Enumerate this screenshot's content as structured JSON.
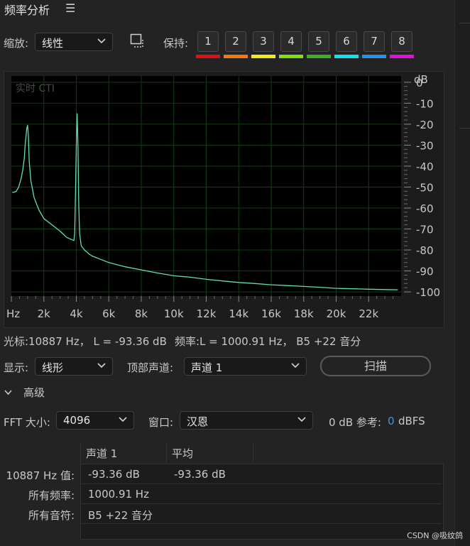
{
  "panel": {
    "title": "频率分析"
  },
  "toolbar": {
    "scale_label": "缩放:",
    "scale_value": "线性",
    "hold_label": "保持:",
    "hold_buttons": [
      "1",
      "2",
      "3",
      "4",
      "5",
      "6",
      "7",
      "8"
    ],
    "hold_colors": [
      "#e01010",
      "#f07a10",
      "#f2ea10",
      "#7ee010",
      "#3cb020",
      "#10e0f0",
      "#2a8ef0",
      "#e010e0"
    ]
  },
  "chart_data": {
    "type": "line",
    "overlay_label": "实时 CTI",
    "ylabel": "dB",
    "ylim": [
      -102,
      3
    ],
    "xlim": [
      0,
      24000
    ],
    "grid": true,
    "x_tick_labels": [
      "Hz",
      "2k",
      "4k",
      "6k",
      "8k",
      "10k",
      "12k",
      "14k",
      "16k",
      "18k",
      "20k",
      "22k"
    ],
    "y_tick_labels": [
      "0",
      "-10",
      "-20",
      "-30",
      "-40",
      "-50",
      "-60",
      "-70",
      "-80",
      "-90",
      "-100"
    ],
    "series": [
      {
        "color": "#5fe0b0",
        "x": [
          50,
          150,
          300,
          450,
          600,
          700,
          800,
          850,
          900,
          950,
          1000,
          1050,
          1100,
          1200,
          1400,
          1700,
          2000,
          2500,
          3000,
          3400,
          3700,
          3850,
          3900,
          3950,
          4000,
          4050,
          4100,
          4150,
          4200,
          4300,
          4500,
          4800,
          5000,
          5500,
          6000,
          7000,
          8000,
          9000,
          10000,
          11000,
          12000,
          13000,
          14000,
          15000,
          16000,
          17000,
          18000,
          19000,
          20000,
          21000,
          22000,
          23000,
          23800
        ],
        "y": [
          -52.5,
          -52.5,
          -52,
          -50,
          -46,
          -42,
          -36,
          -30,
          -26,
          -22,
          -20.5,
          -26,
          -38,
          -47,
          -55,
          -61,
          -65,
          -68,
          -71,
          -74,
          -75,
          -75.5,
          -72,
          -52,
          -30,
          -15,
          -30,
          -58,
          -72,
          -78,
          -80,
          -82,
          -83,
          -84.5,
          -86,
          -88,
          -89.5,
          -91,
          -92.3,
          -93,
          -94,
          -94.8,
          -95.5,
          -96,
          -96.6,
          -97,
          -97.4,
          -97.8,
          -98.3,
          -98.5,
          -98.7,
          -98.9,
          -99
        ]
      }
    ]
  },
  "status": {
    "cursor_text": "光标:10887 Hz， L = -93.36 dB",
    "freq_text": "频率:L = 1000.91 Hz，  B5 +22 音分"
  },
  "display": {
    "label": "显示:",
    "value": "线形",
    "top_channel_label": "顶部声道:",
    "top_channel_value": "声道 1",
    "scan_label": "扫描"
  },
  "advanced": {
    "label": "高级",
    "fft_label": "FFT 大小:",
    "fft_value": "4096",
    "window_label": "窗口:",
    "window_value": "汉恩",
    "ref_label": "0 dB 参考:",
    "ref_value": "0",
    "ref_unit": "dBFS"
  },
  "table": {
    "headers": [
      "声道 1",
      "平均"
    ],
    "rows": [
      {
        "label": "10887 Hz 值:",
        "cells": [
          "-93.36 dB",
          "-93.36 dB"
        ]
      },
      {
        "label": "所有频率:",
        "cells": [
          "1000.91 Hz",
          ""
        ]
      },
      {
        "label": "所有音符:",
        "cells": [
          "B5 +22 音分",
          ""
        ]
      }
    ]
  },
  "watermark": "CSDN @吸纹鸽"
}
